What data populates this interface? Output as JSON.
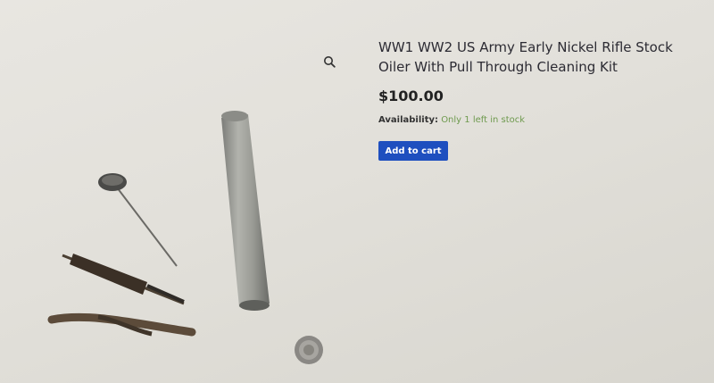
{
  "product": {
    "title": "WW1 WW2 US Army Early Nickel Rifle Stock Oiler With Pull Through Cleaning Kit",
    "price": "$100.00",
    "availability_label": "Availability:",
    "availability_value": "Only 1 left in stock",
    "add_to_cart_label": "Add to cart"
  },
  "icons": {
    "zoom": "search-icon"
  },
  "colors": {
    "button": "#1e4fbf",
    "in_stock": "#6e9a4e"
  }
}
